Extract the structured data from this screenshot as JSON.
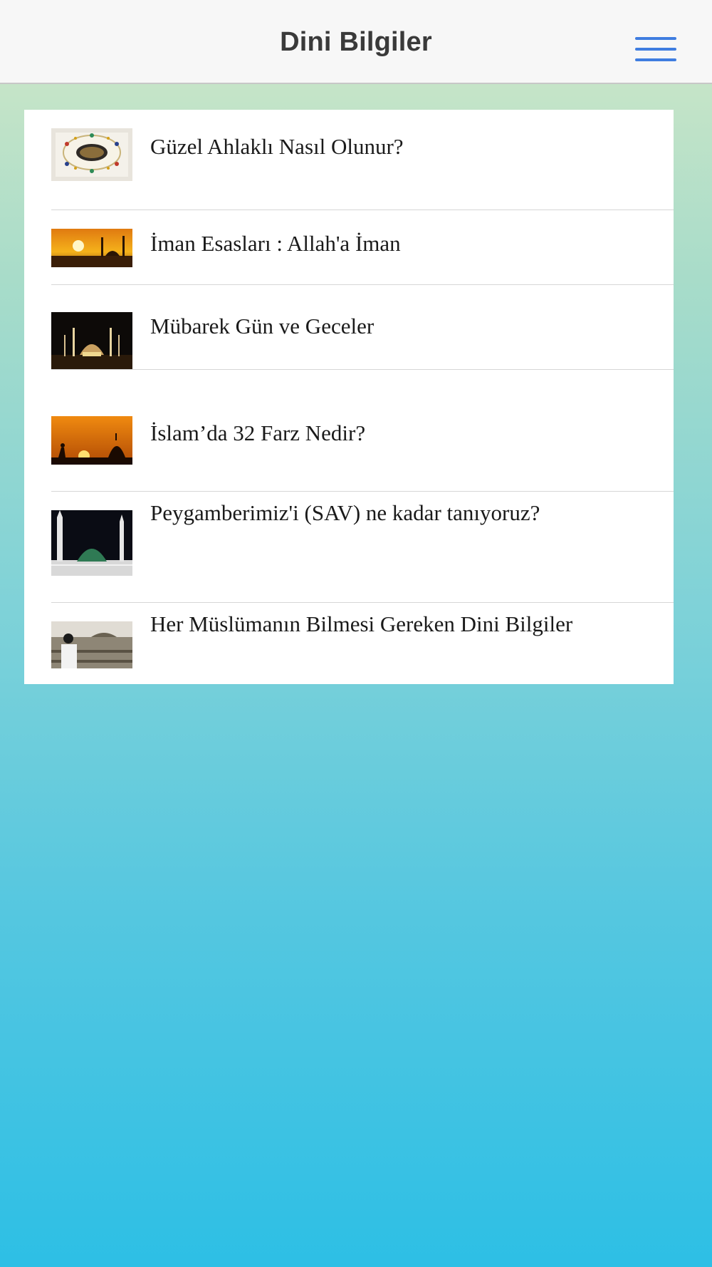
{
  "navbar": {
    "title": "Dini Bilgiler",
    "menu_icon": "hamburger-menu-icon"
  },
  "articles": [
    {
      "title": "Güzel Ahlaklı Nasıl Olunur?",
      "thumbnail": "quran-book-image"
    },
    {
      "title": "İman Esasları : Allah'a İman",
      "thumbnail": "sunset-mosque-image"
    },
    {
      "title": "Mübarek Gün ve Geceler",
      "thumbnail": "night-mosque-image"
    },
    {
      "title": "İslam’da 32 Farz Nedir?",
      "thumbnail": "prayer-silhouette-image"
    },
    {
      "title": "Peygamberimiz'i (SAV) ne kadar tanıyoruz?",
      "thumbnail": "green-dome-image"
    },
    {
      "title": "Her Müslümanın Bilmesi Gereken Dini Bilgiler",
      "thumbnail": "kaaba-crowd-image"
    }
  ],
  "colors": {
    "accent": "#3f7de0",
    "nav_background": "#f7f7f7",
    "gradient_top": "#d2e8c8",
    "gradient_bottom": "#2dbfe5"
  }
}
